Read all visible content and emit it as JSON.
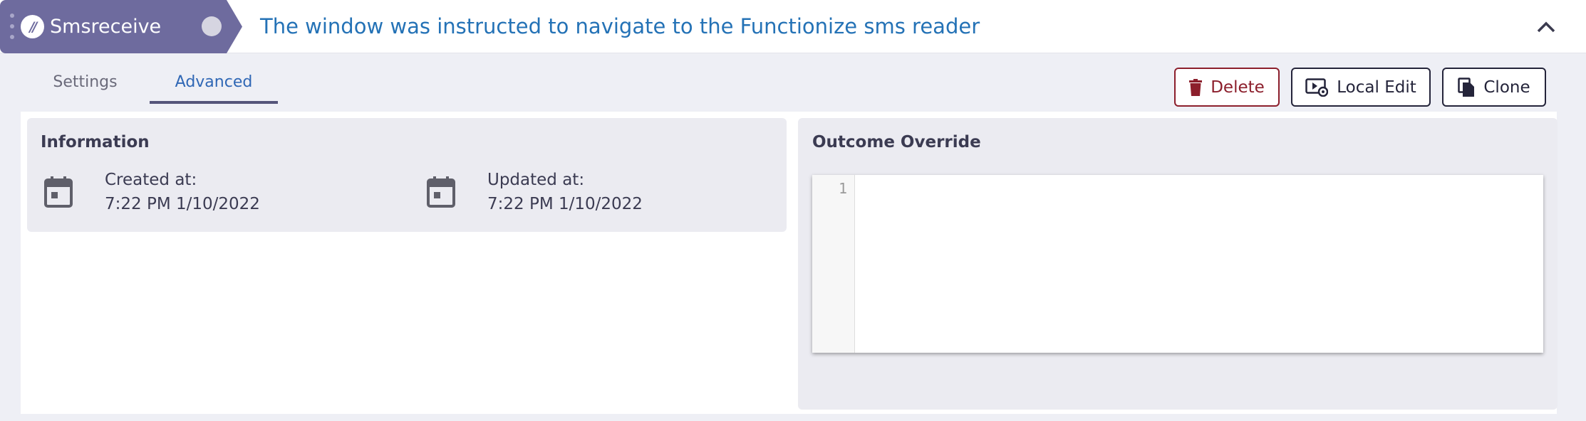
{
  "header": {
    "step_name": "Smsreceive",
    "logo_text": "//",
    "description": "The window was instructed to navigate to the Functionize sms reader",
    "collapse_icon": "chevron-up-icon"
  },
  "tabs": [
    {
      "label": "Settings",
      "active": false
    },
    {
      "label": "Advanced",
      "active": true
    }
  ],
  "actions": {
    "delete_label": "Delete",
    "local_edit_label": "Local Edit",
    "clone_label": "Clone"
  },
  "information": {
    "title": "Information",
    "created_label": "Created at:",
    "created_value": "7:22 PM 1/10/2022",
    "updated_label": "Updated at:",
    "updated_value": "7:22 PM 1/10/2022"
  },
  "outcome_override": {
    "title": "Outcome Override",
    "line_numbers": [
      "1"
    ],
    "code": ""
  },
  "colors": {
    "brand_purple": "#6e6b9e",
    "link_blue": "#2472b6",
    "delete_red": "#8c1f2c",
    "panel_bg": "#ebebf1"
  }
}
